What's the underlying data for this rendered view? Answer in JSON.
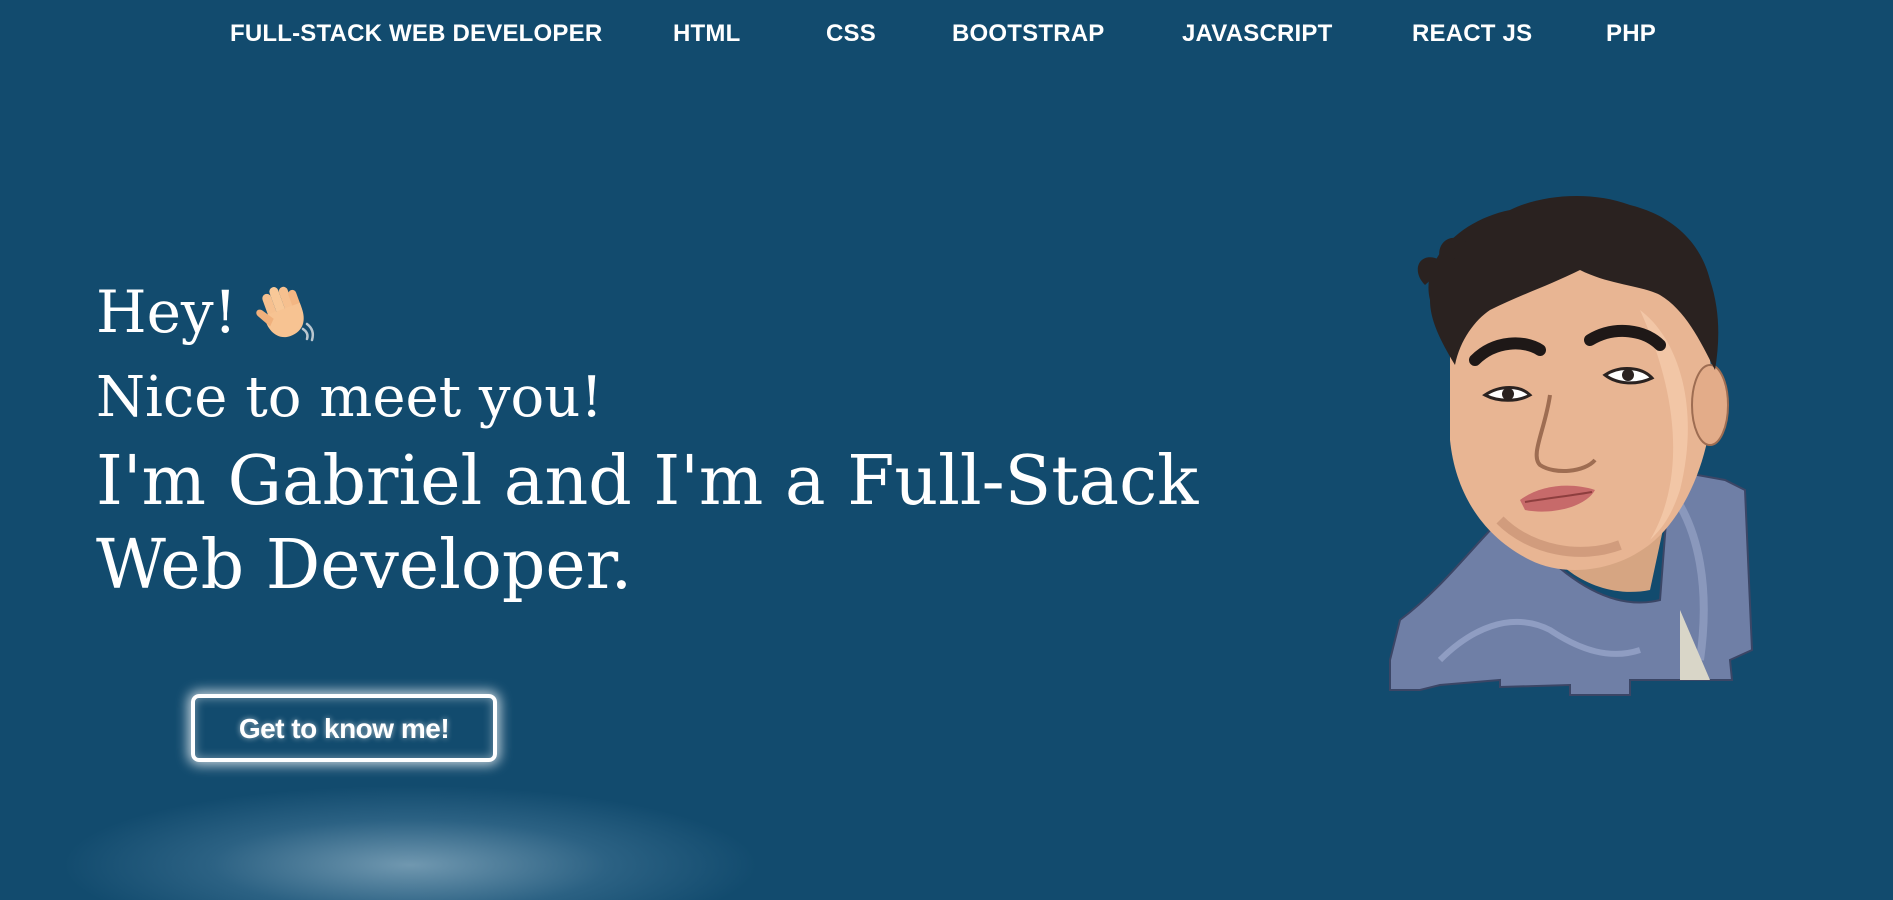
{
  "nav": {
    "items": [
      {
        "label": "FULL-STACK WEB DEVELOPER"
      },
      {
        "label": "HTML"
      },
      {
        "label": "CSS"
      },
      {
        "label": "BOOTSTRAP"
      },
      {
        "label": "JAVASCRIPT"
      },
      {
        "label": "REACT JS"
      },
      {
        "label": "PHP"
      }
    ]
  },
  "hero": {
    "greeting": "Hey!",
    "greeting_icon": "waving-hand-icon",
    "subtitle": "Nice to meet you!",
    "intro": "I'm Gabriel and I'm a Full-Stack Web Developer."
  },
  "cta": {
    "label": "Get to know me!"
  },
  "avatar": {
    "icon": "avatar-illustration"
  },
  "colors": {
    "background": "#124b6e",
    "text": "#ffffff"
  }
}
